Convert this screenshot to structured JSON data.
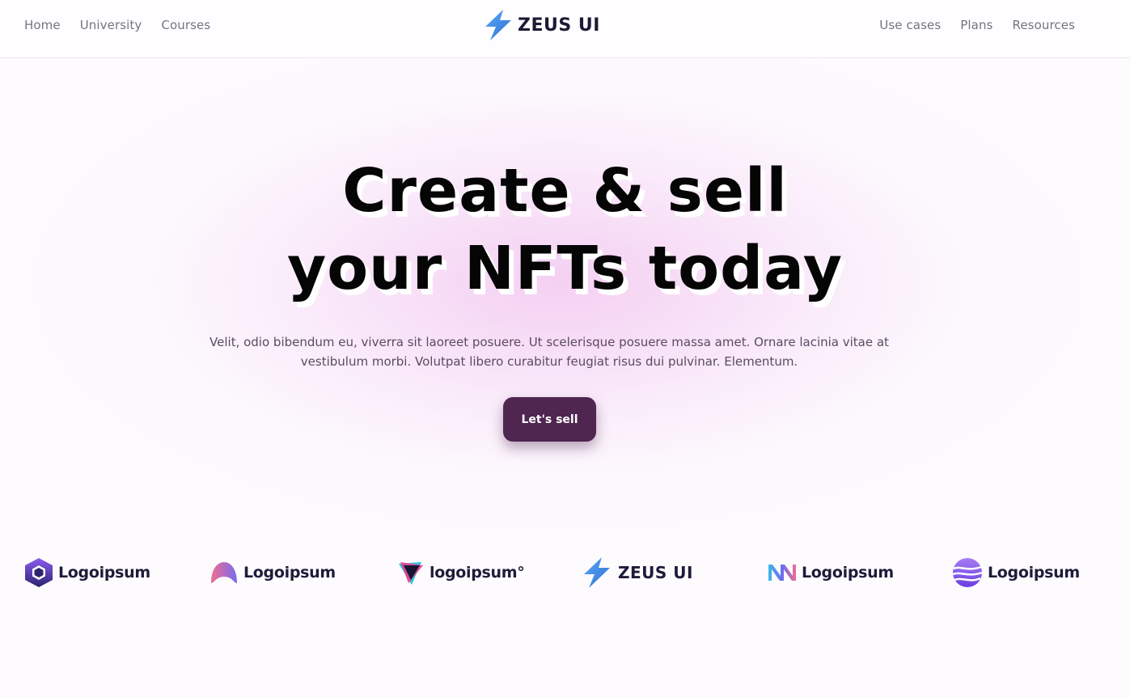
{
  "nav": {
    "left": [
      "Home",
      "University",
      "Courses"
    ],
    "right": [
      "Use cases",
      "Plans",
      "Resources"
    ],
    "brand": "ZEUS UI"
  },
  "hero": {
    "title_line1": "Create & sell",
    "title_line2": "your NFTs today",
    "description": "Velit, odio bibendum eu, viverra sit laoreet posuere. Ut scelerisque posuere massa amet. Ornare lacinia vitae at vestibulum morbi. Volutpat libero curabitur feugiat risus dui pulvinar. Elementum.",
    "cta_label": "Let's sell"
  },
  "logos": [
    {
      "icon": "hexagon-logo-icon"
    },
    {
      "icon": "arch-logo-icon"
    },
    {
      "icon": "triangle-logo-icon"
    },
    {
      "icon": "lightning-bolt-icon",
      "text": "ZEUS UI"
    },
    {
      "icon": "stripes-logo-icon"
    },
    {
      "icon": "waves-sphere-logo-icon"
    }
  ],
  "logo_wordmarks": {
    "logo1": "Logoipsum",
    "logo2": "Logoipsum",
    "logo3": "logoipsum°",
    "logo4": "ZEUS UI",
    "logo5": "Logoipsum",
    "logo6": "Logoipsum"
  },
  "colors": {
    "accent": "#4f2650",
    "brand_blue": "#3b82e6",
    "text_dark": "#050505",
    "nav_text": "#77737c",
    "glow": "#f3c8f0"
  }
}
